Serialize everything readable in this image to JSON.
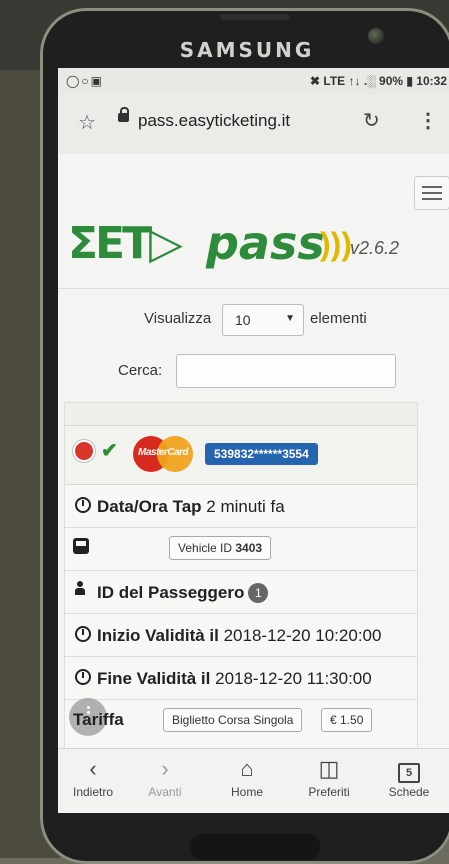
{
  "device": {
    "brand": "SAMSUNG"
  },
  "statusbar": {
    "left_icons": "◯○▣",
    "right": "✖ LTE ↑↓ .░ 90% ▮ 10:32"
  },
  "browser": {
    "url": "pass.easyticketing.it"
  },
  "logo": {
    "et": "ΣET▷",
    "pass": "pass",
    "waves": ")))",
    "version": "v2.6.2"
  },
  "table_controls": {
    "show_label": "Visualizza",
    "show_value": "10",
    "show_after": "elementi",
    "search_label": "Cerca:",
    "search_value": ""
  },
  "record": {
    "card_brand": "MasterCard",
    "pan": "539832******3554",
    "tap_label": "Data/Ora Tap",
    "tap_value": "2 minuti fa",
    "vehicle_label": "Vehicle ID",
    "vehicle_id": "3403",
    "passenger_label": "ID del Passeggero",
    "passenger_id": "1",
    "start_label": "Inizio Validità il",
    "start_value": "2018-12-20 10:20:00",
    "end_label": "Fine Validità il",
    "end_value": "2018-12-20 11:30:00",
    "fare_label": "Tariffa",
    "fare_type": "Biglietto Corsa Singola",
    "fare_price": "€ 1.50"
  },
  "nav": {
    "back": "Indietro",
    "forward": "Avanti",
    "home": "Home",
    "favorites": "Preferiti",
    "tabs": "Schede",
    "tabs_count": "5"
  }
}
